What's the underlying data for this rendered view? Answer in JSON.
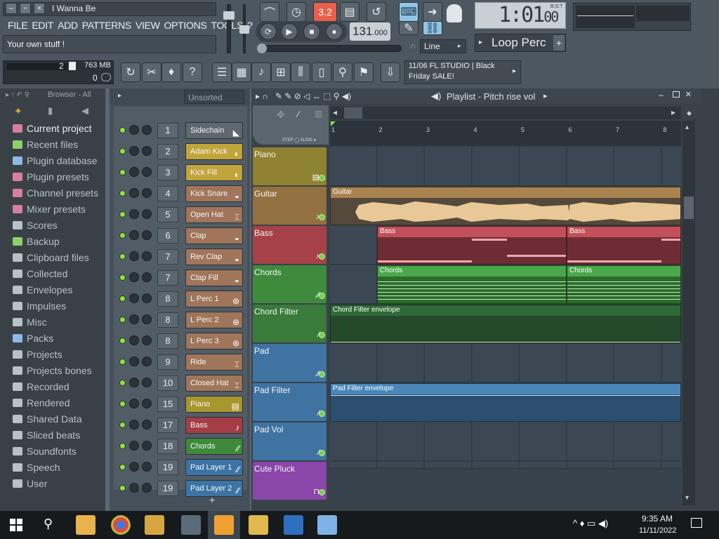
{
  "window": {
    "title": "I Wanna Be",
    "hint": "Your own stuff !"
  },
  "menu": [
    "FILE",
    "EDIT",
    "ADD",
    "PATTERNS",
    "VIEW",
    "OPTIONS",
    "TOOLS",
    "?"
  ],
  "monitor": {
    "cpu_value": "2",
    "memory": "763 MB",
    "voices": "0"
  },
  "toolbar": {
    "pattern_num": "3.2",
    "tempo": "131",
    "tempo_fraction": ".000",
    "time": "1:01",
    "time_frac": "00",
    "time_label": "B:S:T",
    "pattern_name": "Loop Perc",
    "snap": "Line"
  },
  "news": {
    "line1": "11/06  FL STUDIO | Black",
    "line2": "Friday SALE!"
  },
  "browser": {
    "title": "Browser - All",
    "items": [
      {
        "label": "Current project",
        "color": "#d67fa0"
      },
      {
        "label": "Recent files",
        "color": "#8ed06a"
      },
      {
        "label": "Plugin database",
        "color": "#8fb8e6"
      },
      {
        "label": "Plugin presets",
        "color": "#d67fa0"
      },
      {
        "label": "Channel presets",
        "color": "#d67fa0"
      },
      {
        "label": "Mixer presets",
        "color": "#d67fa0"
      },
      {
        "label": "Scores",
        "color": "#b7c1c8"
      },
      {
        "label": "Backup",
        "color": "#8ed06a"
      },
      {
        "label": "Clipboard files",
        "color": "#b7c1c8"
      },
      {
        "label": "Collected",
        "color": "#b7c1c8"
      },
      {
        "label": "Envelopes",
        "color": "#b7c1c8"
      },
      {
        "label": "Impulses",
        "color": "#b7c1c8"
      },
      {
        "label": "Misc",
        "color": "#b7c1c8"
      },
      {
        "label": "Packs",
        "color": "#8fb8e6"
      },
      {
        "label": "Projects",
        "color": "#b7c1c8"
      },
      {
        "label": "Projects bones",
        "color": "#b7c1c8"
      },
      {
        "label": "Recorded",
        "color": "#b7c1c8"
      },
      {
        "label": "Rendered",
        "color": "#b7c1c8"
      },
      {
        "label": "Shared Data",
        "color": "#b7c1c8"
      },
      {
        "label": "Sliced beats",
        "color": "#b7c1c8"
      },
      {
        "label": "Soundfonts",
        "color": "#b7c1c8"
      },
      {
        "label": "Speech",
        "color": "#b7c1c8"
      },
      {
        "label": "User",
        "color": "#b7c1c8"
      }
    ]
  },
  "rack": {
    "filter": "Unsorted",
    "channels": [
      {
        "num": "1",
        "name": "Sidechain",
        "color": "#5f686f",
        "icon": "◣"
      },
      {
        "num": "2",
        "name": "Adam Kick",
        "color": "#c2a53a",
        "icon": "◐"
      },
      {
        "num": "3",
        "name": "Kick Fill",
        "color": "#c2a53a",
        "icon": "◐"
      },
      {
        "num": "4",
        "name": "Kick Snare",
        "color": "#a0755a",
        "icon": "◒"
      },
      {
        "num": "5",
        "name": "Open Hat",
        "color": "#a0755a",
        "icon": "⌶"
      },
      {
        "num": "6",
        "name": "Clap",
        "color": "#a0755a",
        "icon": "◒"
      },
      {
        "num": "7",
        "name": "Rev Clap",
        "color": "#a0755a",
        "icon": "◒"
      },
      {
        "num": "7",
        "name": "Clap Fill",
        "color": "#a0755a",
        "icon": "◒"
      },
      {
        "num": "8",
        "name": "L Perc 1",
        "color": "#a0755a",
        "icon": "⊛"
      },
      {
        "num": "8",
        "name": "L Perc 2",
        "color": "#a0755a",
        "icon": "⊛"
      },
      {
        "num": "8",
        "name": "L Perc 3",
        "color": "#a0755a",
        "icon": "⊛"
      },
      {
        "num": "9",
        "name": "Ride",
        "color": "#a0755a",
        "icon": "⌶"
      },
      {
        "num": "10",
        "name": "Closed Hat",
        "color": "#a0755a",
        "icon": "⌶"
      },
      {
        "num": "15",
        "name": "Piano",
        "color": "#a8962e",
        "icon": "▤"
      },
      {
        "num": "17",
        "name": "Bass",
        "color": "#a53d45",
        "icon": "♪"
      },
      {
        "num": "18",
        "name": "Chords",
        "color": "#3e8a3a",
        "icon": "∕∕"
      },
      {
        "num": "19",
        "name": "Pad Layer 1",
        "color": "#3d74a6",
        "icon": "∕∕"
      },
      {
        "num": "19",
        "name": "Pad Layer 2",
        "color": "#3d74a6",
        "icon": "∕∕"
      }
    ]
  },
  "playlist": {
    "title": "Playlist - Pitch rise vol",
    "bars": [
      "1",
      "2",
      "3",
      "4",
      "5",
      "6",
      "7",
      "8"
    ],
    "tracks": [
      {
        "name": "Piano",
        "color": "#8f8231",
        "icon": "▤"
      },
      {
        "name": "Guitar",
        "color": "#92703f",
        "icon": "♪"
      },
      {
        "name": "Bass",
        "color": "#a64148",
        "icon": "♪"
      },
      {
        "name": "Chords",
        "color": "#3f8b3d",
        "icon": "∕∕"
      },
      {
        "name": "Chord Filter",
        "color": "#3a7a3b",
        "icon": "∕"
      },
      {
        "name": "Pad",
        "color": "#3f73a2",
        "icon": "∕∕"
      },
      {
        "name": "Pad Filter",
        "color": "#3f73a2",
        "icon": "∕"
      },
      {
        "name": "Pad Vol",
        "color": "#3f73a2",
        "icon": "∕"
      },
      {
        "name": "Cute Pluck",
        "color": "#8a46a8",
        "icon": "⊓"
      }
    ],
    "clips": {
      "guitar": "Guitar",
      "bass1": "Bass",
      "bass2": "Bass",
      "chords1": "Chords",
      "chords2": "Chords",
      "chord_filter": "Chord Filter envelope",
      "pad_filter": "Pad Filter envelope"
    }
  },
  "taskbar": {
    "time": "9:35 AM",
    "date": "11/11/2022"
  }
}
